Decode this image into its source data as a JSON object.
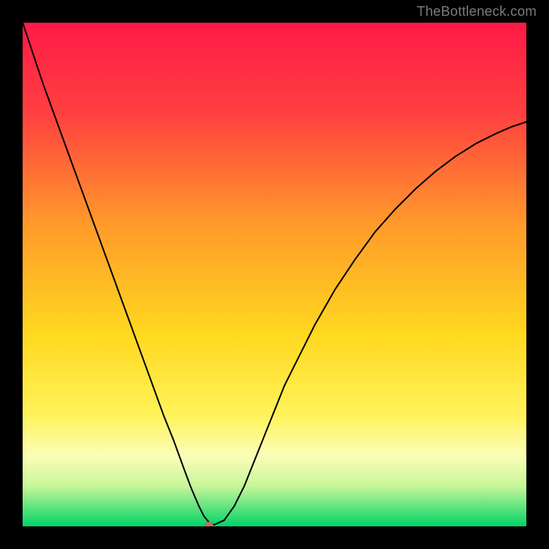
{
  "watermark": "TheBottleneck.com",
  "chart_data": {
    "type": "line",
    "title": "",
    "xlabel": "",
    "ylabel": "",
    "xlim": [
      0,
      100
    ],
    "ylim": [
      0,
      100
    ],
    "grid": false,
    "legend": false,
    "background": {
      "type": "vertical-gradient",
      "description": "red at top through orange, yellow, pale-yellow to green at bottom",
      "stops": [
        {
          "pos": 0.0,
          "color": "#ff1a47"
        },
        {
          "pos": 0.18,
          "color": "#ff4040"
        },
        {
          "pos": 0.4,
          "color": "#ff9a2a"
        },
        {
          "pos": 0.62,
          "color": "#ffd81f"
        },
        {
          "pos": 0.78,
          "color": "#fff35a"
        },
        {
          "pos": 0.86,
          "color": "#fbfdb8"
        },
        {
          "pos": 0.92,
          "color": "#c8f69a"
        },
        {
          "pos": 0.965,
          "color": "#58e27c"
        },
        {
          "pos": 1.0,
          "color": "#00d468"
        }
      ]
    },
    "series": [
      {
        "name": "bottleneck-curve",
        "color": "#000000",
        "x": [
          0,
          2,
          4,
          6,
          8,
          10,
          12,
          14,
          16,
          18,
          20,
          22,
          24,
          26,
          28,
          30,
          32,
          33.5,
          35,
          36,
          37,
          38,
          40,
          42,
          44,
          46,
          48,
          50,
          52,
          55,
          58,
          62,
          66,
          70,
          74,
          78,
          82,
          86,
          90,
          94,
          97,
          100
        ],
        "y": [
          100,
          94,
          88,
          82.5,
          77,
          71.5,
          66,
          60.5,
          55,
          49.5,
          44,
          38.5,
          33,
          27.5,
          22,
          17,
          11.5,
          7.5,
          4,
          2,
          0.8,
          0.3,
          1.2,
          4,
          8,
          13,
          18,
          23,
          28,
          34,
          40,
          47,
          53,
          58.5,
          63,
          67,
          70.5,
          73.5,
          76,
          78,
          79.3,
          80.3
        ]
      }
    ],
    "marker": {
      "name": "optimal-point",
      "x": 37,
      "y": 0.3,
      "color": "#cc6b5a",
      "rx": 6,
      "ry": 4.5
    }
  }
}
